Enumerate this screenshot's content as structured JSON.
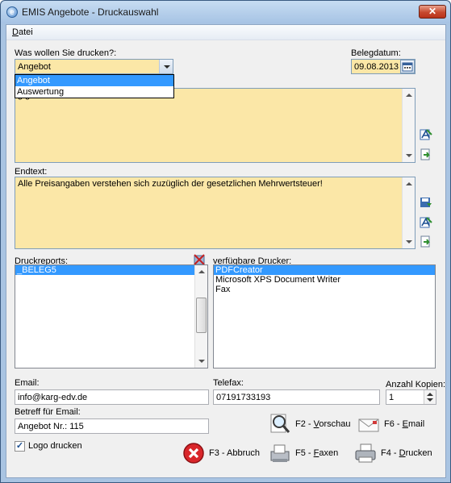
{
  "window": {
    "title": "EMIS Angebote - Druckauswahl",
    "close": "✕",
    "icon": "app-globe-icon"
  },
  "menu": {
    "datei_prefix": "D",
    "datei_rest": "atei"
  },
  "druck": {
    "label": "Was wollen Sie drucken?:",
    "selected": "Angebot",
    "options": [
      "Angebot",
      "Auswertung"
    ]
  },
  "belegdatum": {
    "label": "Belegdatum:",
    "value": "09.08.2013"
  },
  "starttext": {
    "partial": "g                                    gebot:"
  },
  "endtext": {
    "label": "Endtext:",
    "value": "Alle Preisangaben verstehen sich zuzüglich der gesetzlichen Mehrwertsteuer!"
  },
  "druckreports": {
    "label": "Druckreports:",
    "items": [
      "_BELEG5"
    ]
  },
  "drucker": {
    "label": "verfügbare Drucker:",
    "items": [
      "PDFCreator",
      "Microsoft XPS Document Writer",
      "Fax"
    ]
  },
  "email": {
    "label": "Email:",
    "value": "info@karg-edv.de"
  },
  "telefax": {
    "label": "Telefax:",
    "value": "07191733193"
  },
  "kopien": {
    "label": "Anzahl Kopien:",
    "value": "1"
  },
  "betreff": {
    "label": "Betreff für Email:",
    "value": "Angebot Nr.: 115"
  },
  "logo": {
    "label": "Logo drucken",
    "checked": "✓"
  },
  "actions": {
    "vorschau_key": "F2 - ",
    "vorschau_u": "V",
    "vorschau_rest": "orschau",
    "email_key": "F6 - ",
    "email_u": "E",
    "email_rest": "mail",
    "abbruch": "F3 - Abbruch",
    "faxen_key": "F5 - ",
    "faxen_u": "F",
    "faxen_rest": "axen",
    "drucken_key": "F4 - ",
    "drucken_u": "D",
    "drucken_rest": "rucken"
  },
  "colors": {
    "field_bg": "#fbe7a7",
    "selection": "#3399ff",
    "title_bar": "#a9c4e2"
  }
}
